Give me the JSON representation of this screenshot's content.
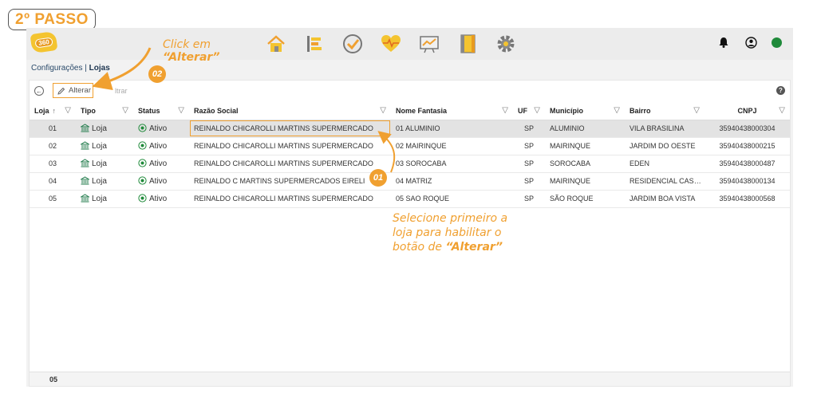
{
  "step_badge": "2º PASSO",
  "app": {
    "logo_text": "360",
    "modules": [
      {
        "icon": "home-icon"
      },
      {
        "icon": "list-icon"
      },
      {
        "icon": "check-circle-icon"
      },
      {
        "icon": "heart-pulse-icon"
      },
      {
        "icon": "chart-board-icon"
      },
      {
        "icon": "notebook-icon"
      },
      {
        "icon": "gear-icon"
      }
    ],
    "top_right": {
      "bell": "bell-icon",
      "user": "user-icon",
      "status_color": "#1f8a3a"
    }
  },
  "breadcrumb": {
    "parent": "Configurações | ",
    "current": "Lojas"
  },
  "toolbar": {
    "alterar_label": "Alterar",
    "ghost_label": "ltrar",
    "help": "?"
  },
  "table": {
    "headers": {
      "loja": "Loja",
      "sort": "↑",
      "tipo": "Tipo",
      "status": "Status",
      "razao": "Razão Social",
      "fantasia": "Nome Fantasia",
      "uf": "UF",
      "municipio": "Município",
      "bairro": "Bairro",
      "cnpj": "CNPJ"
    },
    "rows": [
      {
        "loja": "01",
        "tipo": "Loja",
        "status": "Ativo",
        "razao": "REINALDO CHICAROLLI MARTINS SUPERMERCADO",
        "fantasia": "01 ALUMINIO",
        "uf": "SP",
        "municipio": "ALUMINIO",
        "bairro": "VILA BRASILINA",
        "cnpj": "35940438000304"
      },
      {
        "loja": "02",
        "tipo": "Loja",
        "status": "Ativo",
        "razao": "REINALDO CHICAROLLI MARTINS SUPERMERCADO",
        "fantasia": "02 MAIRINQUE",
        "uf": "SP",
        "municipio": "MAIRINQUE",
        "bairro": "JARDIM DO OESTE",
        "cnpj": "35940438000215"
      },
      {
        "loja": "03",
        "tipo": "Loja",
        "status": "Ativo",
        "razao": "REINALDO CHICAROLLI MARTINS SUPERMERCADO",
        "fantasia": "03 SOROCABA",
        "uf": "SP",
        "municipio": "SOROCABA",
        "bairro": "EDEN",
        "cnpj": "35940438000487"
      },
      {
        "loja": "04",
        "tipo": "Loja",
        "status": "Ativo",
        "razao": "REINALDO C MARTINS SUPERMERCADOS EIRELI",
        "fantasia": "04 MATRIZ",
        "uf": "SP",
        "municipio": "MAIRINQUE",
        "bairro": "RESIDENCIAL CASTA...",
        "cnpj": "35940438000134"
      },
      {
        "loja": "05",
        "tipo": "Loja",
        "status": "Ativo",
        "razao": "REINALDO CHICAROLLI MARTINS SUPERMERCADO",
        "fantasia": "05 SAO ROQUE",
        "uf": "SP",
        "municipio": "SÃO ROQUE",
        "bairro": "JARDIM BOA VISTA",
        "cnpj": "35940438000568"
      }
    ],
    "footer_count": "05"
  },
  "annotations": {
    "click_line1": "Click em",
    "click_line2": "“Alterar”",
    "badge_02": "02",
    "badge_01": "01",
    "select_line1": "Selecione primeiro a",
    "select_line2": "loja para habilitar o",
    "select_line3_prefix": "botão de ",
    "select_line3_bold": "“Alterar”",
    "accent_color": "#f0a030"
  }
}
